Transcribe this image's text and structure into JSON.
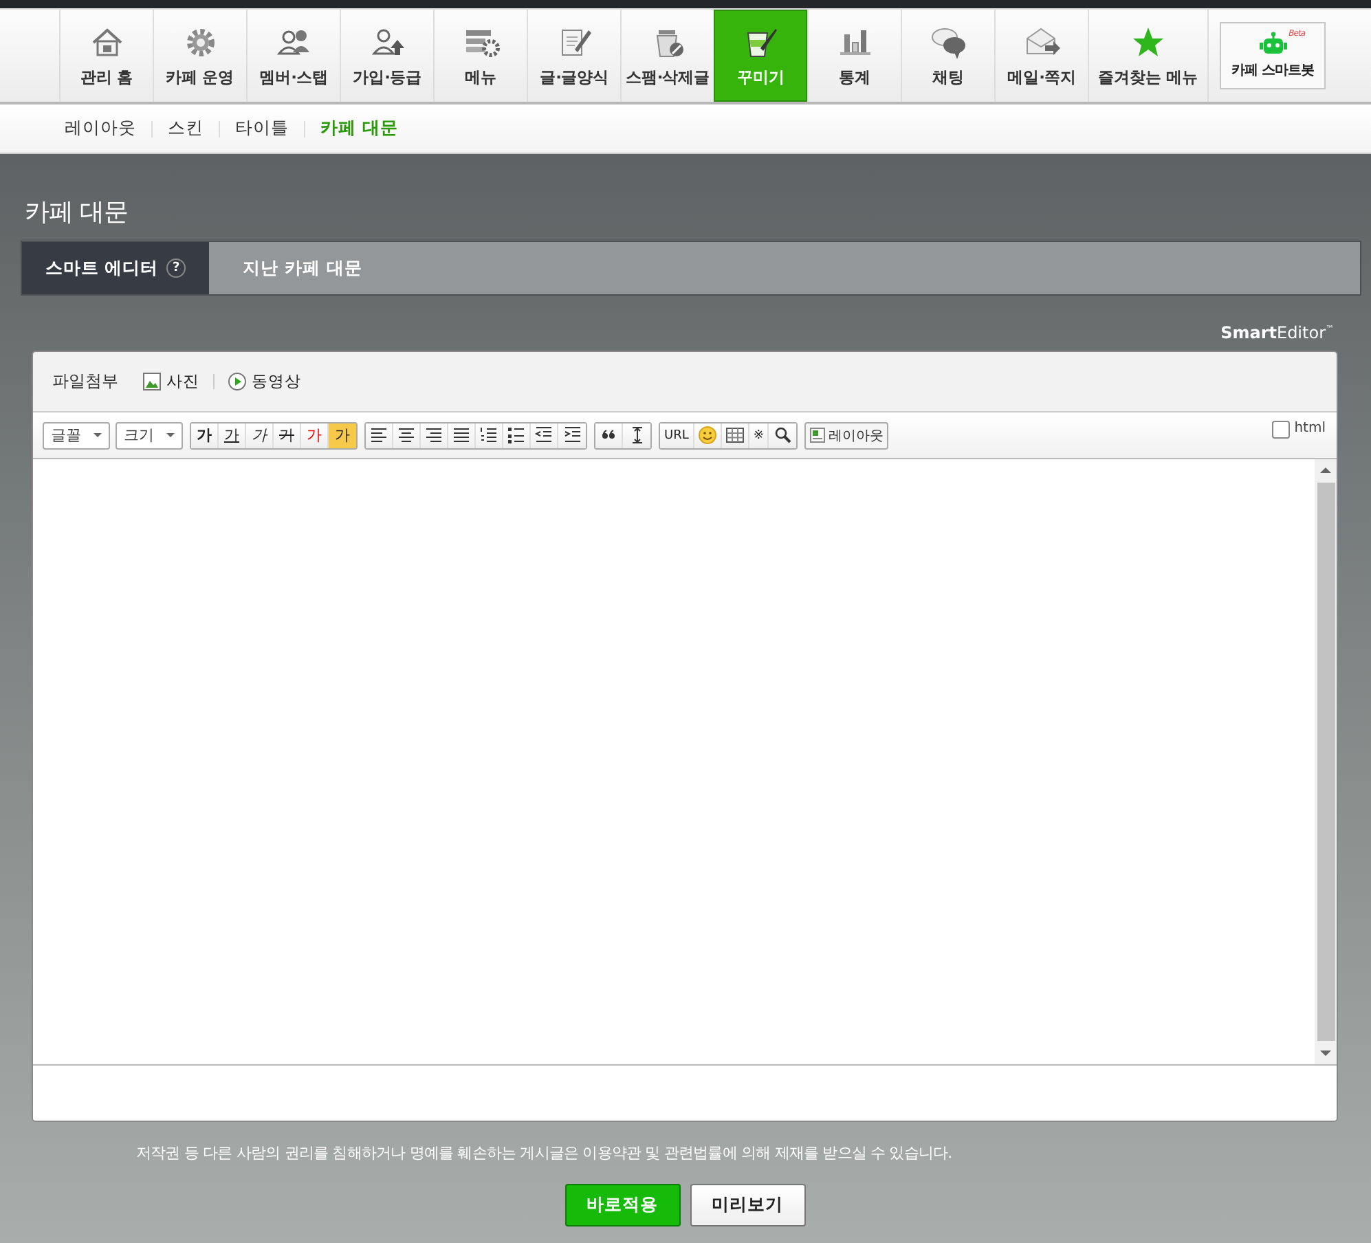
{
  "nav": {
    "items": [
      {
        "label": "관리 홈",
        "selected": false
      },
      {
        "label": "카페 운영",
        "selected": false
      },
      {
        "label": "멤버·스탭",
        "selected": false
      },
      {
        "label": "가입·등급",
        "selected": false
      },
      {
        "label": "메뉴",
        "selected": false
      },
      {
        "label": "글·글양식",
        "selected": false
      },
      {
        "label": "스팸·삭제글",
        "selected": false
      },
      {
        "label": "꾸미기",
        "selected": true
      },
      {
        "label": "통계",
        "selected": false
      },
      {
        "label": "채팅",
        "selected": false
      },
      {
        "label": "메일·쪽지",
        "selected": false
      },
      {
        "label": "즐겨찾는 메뉴",
        "selected": false
      }
    ],
    "smartbot": {
      "label": "카페 스마트봇",
      "badge": "Beta"
    }
  },
  "subnav": [
    {
      "label": "레이아웃",
      "selected": false
    },
    {
      "label": "스킨",
      "selected": false
    },
    {
      "label": "타이틀",
      "selected": false
    },
    {
      "label": "카페 대문",
      "selected": true
    }
  ],
  "page_title": "카페 대문",
  "tabs": [
    {
      "label": "스마트 에디터",
      "help": "?",
      "selected": true
    },
    {
      "label": "지난 카페 대문",
      "selected": false
    }
  ],
  "editor": {
    "logo": "**Smart**Editor$^{™}$",
    "attach": {
      "label": "파일첨부",
      "items": [
        {
          "kind": "photo",
          "label": "사진"
        },
        {
          "kind": "video",
          "label": "동영상"
        }
      ]
    },
    "toolbar": [
      [
        {
          "kind": "select",
          "label": "글꼴"
        },
        {
          "kind": "select",
          "label": "크기"
        }
      ],
      [
        {
          "kind": "bold",
          "label": "가"
        },
        {
          "kind": "underline",
          "label": "가"
        },
        {
          "kind": "italic",
          "label": "가"
        },
        {
          "kind": "strike",
          "label": "가"
        },
        {
          "kind": "color",
          "label": "가"
        },
        {
          "kind": "highlight",
          "label": "가"
        }
      ],
      [
        {
          "kind": "align-left"
        },
        {
          "kind": "align-center"
        },
        {
          "kind": "align-right"
        },
        {
          "kind": "justify"
        },
        {
          "kind": "numbered-list"
        },
        {
          "kind": "bullet-list"
        },
        {
          "kind": "outdent"
        },
        {
          "kind": "indent"
        }
      ],
      [
        {
          "kind": "quote"
        },
        {
          "kind": "line-height"
        }
      ],
      [
        {
          "kind": "text",
          "label": "URL"
        },
        {
          "kind": "emoticon"
        },
        {
          "kind": "table"
        },
        {
          "kind": "text",
          "label": "※"
        },
        {
          "kind": "search"
        }
      ],
      [
        {
          "kind": "layout",
          "label": "레이아웃"
        }
      ]
    ],
    "html_toggle": {
      "label": "html",
      "checked": false
    }
  },
  "notice": "저작권 등 다른 사람의 권리를 침해하거나 명예를 훼손하는 게시글은 이용약관 및 관련법률에 의해 제재를 받으실 수 있습니다.",
  "buttons": [
    {
      "label": "바로적용",
      "kind": "primary"
    },
    {
      "label": "미리보기",
      "kind": "secondary"
    }
  ]
}
